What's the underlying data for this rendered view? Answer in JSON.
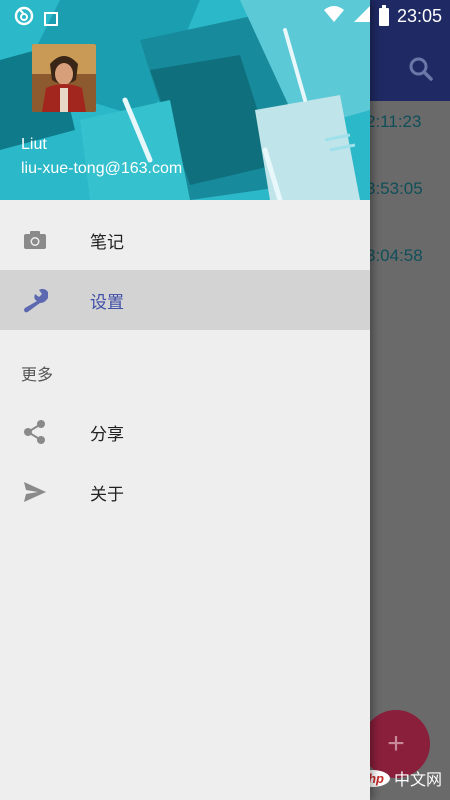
{
  "status_bar": {
    "time": "23:05",
    "icons": [
      "notification-app-icon",
      "stop-square-icon",
      "wifi-icon",
      "signal-icon",
      "battery-icon"
    ]
  },
  "background_app": {
    "search_icon": "search-icon",
    "times": [
      "2:11:23",
      "3:53:05",
      "3:04:58"
    ],
    "fab_label": "+"
  },
  "drawer": {
    "header": {
      "user_name": "Liut",
      "user_email": "liu-xue-tong@163.com"
    },
    "items": [
      {
        "label": "笔记",
        "icon": "camera-icon",
        "active": false
      },
      {
        "label": "设置",
        "icon": "wrench-icon",
        "active": true
      }
    ],
    "section_title": "更多",
    "more_items": [
      {
        "label": "分享",
        "icon": "share-icon"
      },
      {
        "label": "关于",
        "icon": "send-icon"
      }
    ]
  },
  "watermark": {
    "badge": "php",
    "text": "中文网"
  },
  "colors": {
    "accent": "#3f4ea8",
    "toolbar": "#1f2a64",
    "header": "#28b7c6",
    "fab": "#8a1f3c"
  }
}
